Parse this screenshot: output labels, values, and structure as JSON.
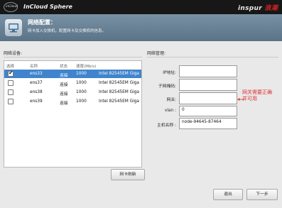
{
  "app": {
    "logo_small": "inCloud",
    "product_name": "InCloud Sphere",
    "brand_main": "inspur",
    "brand_accent": "浪潮"
  },
  "header": {
    "icon": "network-config-icon",
    "title": "网络配置：",
    "subtitle": "网卡加入交换机，配置网卡及交换机的信息。"
  },
  "left_panel": {
    "label": "网络设备:",
    "columns": [
      "选择",
      "名称",
      "状态",
      "速度(Mb/s)"
    ],
    "rows": [
      {
        "checked": true,
        "name": "ens33",
        "state": "连接",
        "speed": "1000",
        "desc": "Intel 82545EM Giga"
      },
      {
        "checked": false,
        "name": "ens37",
        "state": "连接",
        "speed": "1000",
        "desc": "Intel 82545EM Giga"
      },
      {
        "checked": false,
        "name": "ens38",
        "state": "连接",
        "speed": "1000",
        "desc": "Intel 82545EM Giga"
      },
      {
        "checked": false,
        "name": "ens39",
        "state": "连接",
        "speed": "1000",
        "desc": "Intel 82545EM Giga"
      }
    ],
    "refresh_button": "网卡刷新"
  },
  "right_panel": {
    "label": "网络管理:",
    "fields": [
      {
        "label": "IP地址:",
        "value": ""
      },
      {
        "label": "子网掩码:",
        "value": ""
      },
      {
        "label": "网关:",
        "value": ""
      },
      {
        "label": "vlan :",
        "value": "0"
      },
      {
        "label": "主机名称 :",
        "value": "node-94645-87464"
      }
    ]
  },
  "annotation": {
    "line1": "网关需要正确",
    "line2": "并可用",
    "color": "#e03030"
  },
  "footer": {
    "exit_button": "退出",
    "next_button": "下一步"
  },
  "colors": {
    "topbar": "#171717",
    "header": "#6a8296",
    "selected_row": "#3f84cd",
    "brand_accent": "#d32222"
  }
}
